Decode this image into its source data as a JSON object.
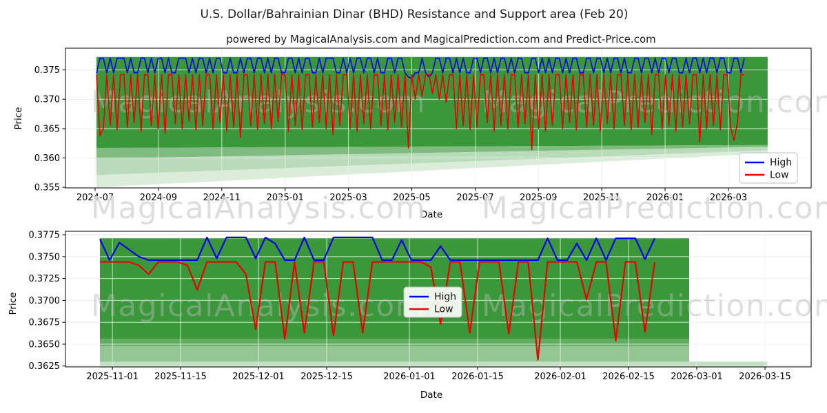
{
  "title": "U.S. Dollar/Bahrainian Dinar (BHD) Resistance and Support area (Feb 20)",
  "subtitle": "powered by MagicalAnalysis.com and MagicalPrediction.com and Predict-Price.com",
  "watermarks": {
    "left": "MagicalAnalysis.com",
    "right": "MagicalPrediction.com"
  },
  "legend": {
    "high": "High",
    "low": "Low"
  },
  "colors": {
    "high_line": "#0000EE",
    "low_line": "#EE0000",
    "band_green": "#3A973A",
    "grid_gray": "#cdcdcd",
    "grid_over_band": "rgba(255,255,255,0.75)",
    "axis": "#000000"
  },
  "chart_data": [
    {
      "type": "line",
      "position": "top",
      "xlabel": "Date",
      "ylabel": "Price",
      "ylim": [
        0.3549,
        0.3787
      ],
      "x_ticks": [
        {
          "label": "2024-07",
          "f": 0.0397
        },
        {
          "label": "2024-09",
          "f": 0.1247
        },
        {
          "label": "2024-11",
          "f": 0.2096
        },
        {
          "label": "2025-01",
          "f": 0.2946
        },
        {
          "label": "2025-03",
          "f": 0.3795
        },
        {
          "label": "2025-05",
          "f": 0.4644
        },
        {
          "label": "2025-07",
          "f": 0.5494
        },
        {
          "label": "2025-09",
          "f": 0.6343
        },
        {
          "label": "2025-11",
          "f": 0.7192
        },
        {
          "label": "2026-01",
          "f": 0.8042
        },
        {
          "label": "2026-03",
          "f": 0.8891
        }
      ],
      "y_ticks": [
        {
          "label": "0.355",
          "v": 0.355
        },
        {
          "label": "0.360",
          "v": 0.36
        },
        {
          "label": "0.365",
          "v": 0.365
        },
        {
          "label": "0.370",
          "v": 0.37
        },
        {
          "label": "0.375",
          "v": 0.375
        }
      ],
      "span": {
        "f0": 0.0416,
        "f1": 0.9104
      },
      "line_width": 1.6,
      "band_color": "#3A973A",
      "bands": [
        {
          "f0": 0.0416,
          "f1": 0.9417,
          "top0": 0.3772,
          "top1": 0.3772,
          "bot0": 0.3617,
          "bot1": 0.3622,
          "opacity": 1
        },
        {
          "f0": 0.0416,
          "f1": 0.9417,
          "top0": 0.3617,
          "top1": 0.3622,
          "bot0": 0.3599,
          "bot1": 0.3619,
          "opacity": 0.65
        },
        {
          "f0": 0.0416,
          "f1": 0.9417,
          "top0": 0.3599,
          "top1": 0.3619,
          "bot0": 0.3571,
          "bot1": 0.3613,
          "opacity": 0.35
        },
        {
          "f0": 0.0416,
          "f1": 0.9417,
          "top0": 0.3571,
          "top1": 0.3613,
          "bot0": 0.355,
          "bot1": 0.3608,
          "opacity": 0.18
        }
      ],
      "series": [
        {
          "name": "High",
          "color": "#0000EE",
          "values": [
            0.3744,
            0.377,
            0.377,
            0.3745,
            0.377,
            0.3745,
            0.377,
            0.377,
            0.377,
            0.3745,
            0.377,
            0.3745,
            0.3745,
            0.377,
            0.377,
            0.3745,
            0.377,
            0.3745,
            0.377,
            0.377,
            0.3745,
            0.377,
            0.3745,
            0.3745,
            0.377,
            0.377,
            0.377,
            0.3745,
            0.377,
            0.3745,
            0.377,
            0.377,
            0.3745,
            0.377,
            0.3745,
            0.377,
            0.377,
            0.3745,
            0.3745,
            0.377,
            0.3745,
            0.3745,
            0.377,
            0.3745,
            0.377,
            0.377,
            0.3745,
            0.377,
            0.377,
            0.3745,
            0.377,
            0.3745,
            0.377,
            0.377,
            0.3745,
            0.3745,
            0.377,
            0.377,
            0.3745,
            0.377,
            0.3745,
            0.377,
            0.377,
            0.3745,
            0.3745,
            0.377,
            0.3745,
            0.377,
            0.377,
            0.377,
            0.3745,
            0.3745,
            0.377,
            0.3745,
            0.377,
            0.3745,
            0.377,
            0.377,
            0.3745,
            0.377,
            0.377,
            0.3745,
            0.377,
            0.3745,
            0.3745,
            0.377,
            0.377,
            0.3745,
            0.377,
            0.377,
            0.3745,
            0.3738,
            0.3735,
            0.3745,
            0.3745,
            0.377,
            0.3745,
            0.3738,
            0.3745,
            0.377,
            0.377,
            0.3745,
            0.377,
            0.377,
            0.3745,
            0.377,
            0.3745,
            0.377,
            0.3745,
            0.3745,
            0.377,
            0.377,
            0.3745,
            0.377,
            0.377,
            0.3745,
            0.377,
            0.3745,
            0.377,
            0.377,
            0.3745,
            0.377,
            0.3745,
            0.377,
            0.377,
            0.3745,
            0.3745,
            0.377,
            0.377,
            0.3745,
            0.377,
            0.3745,
            0.377,
            0.3745,
            0.377,
            0.377,
            0.3745,
            0.377,
            0.3745,
            0.377,
            0.377,
            0.3745,
            0.3745,
            0.377,
            0.377,
            0.3745,
            0.377,
            0.377,
            0.3745,
            0.377,
            0.3745,
            0.377,
            0.377,
            0.3745,
            0.377,
            0.3745,
            0.3745,
            0.377,
            0.377,
            0.3745,
            0.377,
            0.377,
            0.3745,
            0.377,
            0.3745,
            0.377,
            0.377,
            0.3745,
            0.377,
            0.377,
            0.3745,
            0.3745,
            0.377,
            0.3745,
            0.377,
            0.377,
            0.3745,
            0.377,
            0.3745,
            0.377,
            0.377,
            0.3745,
            0.377,
            0.377,
            0.3745,
            0.3745,
            0.377,
            0.377,
            0.3745,
            0.377
          ]
        },
        {
          "name": "Low",
          "color": "#EE0000",
          "values": [
            0.3742,
            0.3638,
            0.365,
            0.3742,
            0.3655,
            0.3742,
            0.3648,
            0.3742,
            0.3742,
            0.3652,
            0.3742,
            0.366,
            0.3742,
            0.3645,
            0.3742,
            0.3742,
            0.3655,
            0.3742,
            0.365,
            0.3742,
            0.3642,
            0.3742,
            0.3742,
            0.3658,
            0.3742,
            0.365,
            0.3742,
            0.3663,
            0.3742,
            0.3648,
            0.3742,
            0.3655,
            0.3742,
            0.3742,
            0.365,
            0.3742,
            0.366,
            0.3742,
            0.3645,
            0.3742,
            0.3652,
            0.3742,
            0.3635,
            0.3742,
            0.3742,
            0.3655,
            0.3742,
            0.3648,
            0.3742,
            0.3658,
            0.3742,
            0.365,
            0.3742,
            0.3662,
            0.3742,
            0.3742,
            0.3645,
            0.3742,
            0.3655,
            0.3742,
            0.3648,
            0.3742,
            0.3742,
            0.3652,
            0.3742,
            0.366,
            0.3742,
            0.365,
            0.3742,
            0.364,
            0.3742,
            0.3655,
            0.3742,
            0.3742,
            0.365,
            0.3742,
            0.3645,
            0.3742,
            0.3658,
            0.3742,
            0.365,
            0.3742,
            0.3742,
            0.3655,
            0.3742,
            0.3648,
            0.3742,
            0.366,
            0.3742,
            0.3652,
            0.3742,
            0.3617,
            0.3742,
            0.37,
            0.3742,
            0.3705,
            0.3742,
            0.3742,
            0.371,
            0.3742,
            0.37,
            0.3742,
            0.3695,
            0.3742,
            0.3742,
            0.365,
            0.3742,
            0.3655,
            0.3742,
            0.3648,
            0.3742,
            0.3652,
            0.3742,
            0.3742,
            0.366,
            0.3742,
            0.3645,
            0.3742,
            0.3655,
            0.3742,
            0.365,
            0.3742,
            0.3742,
            0.3652,
            0.3742,
            0.3658,
            0.3742,
            0.3614,
            0.3742,
            0.365,
            0.3742,
            0.3645,
            0.3742,
            0.3655,
            0.3742,
            0.3742,
            0.365,
            0.3742,
            0.366,
            0.3742,
            0.3648,
            0.3742,
            0.3742,
            0.3652,
            0.3742,
            0.3655,
            0.3742,
            0.3645,
            0.3742,
            0.3658,
            0.3742,
            0.365,
            0.3742,
            0.3742,
            0.3655,
            0.3742,
            0.3648,
            0.3742,
            0.3652,
            0.3742,
            0.366,
            0.3742,
            0.364,
            0.3742,
            0.3742,
            0.365,
            0.3742,
            0.3655,
            0.3742,
            0.3645,
            0.3742,
            0.3652,
            0.3742,
            0.3658,
            0.3742,
            0.3742,
            0.3627,
            0.3742,
            0.365,
            0.3742,
            0.3655,
            0.3742,
            0.3648,
            0.3742,
            0.3742,
            0.3652,
            0.363,
            0.366,
            0.3742,
            0.3742
          ]
        }
      ]
    },
    {
      "type": "line",
      "position": "bottom",
      "xlabel": "Date",
      "ylabel": "Price",
      "ylim": [
        0.3624,
        0.3779
      ],
      "x_ticks": [
        {
          "label": "2025-11-01",
          "f": 0.0629
        },
        {
          "label": "2025-11-15",
          "f": 0.1543
        },
        {
          "label": "2025-12-01",
          "f": 0.2588
        },
        {
          "label": "2025-12-15",
          "f": 0.3503
        },
        {
          "label": "2026-01-01",
          "f": 0.4612
        },
        {
          "label": "2026-01-15",
          "f": 0.5527
        },
        {
          "label": "2026-02-01",
          "f": 0.6636
        },
        {
          "label": "2026-02-15",
          "f": 0.7551
        },
        {
          "label": "2026-03-01",
          "f": 0.8466
        },
        {
          "label": "2026-03-15",
          "f": 0.9381
        }
      ],
      "y_ticks": [
        {
          "label": "0.3625",
          "v": 0.3625
        },
        {
          "label": "0.3650",
          "v": 0.365
        },
        {
          "label": "0.3675",
          "v": 0.3675
        },
        {
          "label": "0.3700",
          "v": 0.37
        },
        {
          "label": "0.3725",
          "v": 0.3725
        },
        {
          "label": "0.3750",
          "v": 0.375
        },
        {
          "label": "0.3775",
          "v": 0.3775
        }
      ],
      "span": {
        "f0": 0.0462,
        "f1": 0.7902
      },
      "line_width": 2.2,
      "band_color": "#3A973A",
      "bands": [
        {
          "f0": 0.0462,
          "f1": 0.8364,
          "top0": 0.3771,
          "top1": 0.3771,
          "bot0": 0.3656,
          "bot1": 0.3656,
          "opacity": 1
        },
        {
          "f0": 0.0462,
          "f1": 0.8364,
          "top0": 0.3656,
          "top1": 0.3656,
          "bot0": 0.3648,
          "bot1": 0.3648,
          "opacity": 0.8
        },
        {
          "f0": 0.0462,
          "f1": 0.8364,
          "top0": 0.3648,
          "top1": 0.3648,
          "bot0": 0.363,
          "bot1": 0.363,
          "opacity": 0.55
        },
        {
          "f0": 0.0462,
          "f1": 0.9409,
          "top0": 0.363,
          "top1": 0.363,
          "bot0": 0.3623,
          "bot1": 0.3623,
          "opacity": 0.3
        }
      ],
      "series": [
        {
          "name": "High",
          "color": "#0000EE",
          "values": [
            0.377,
            0.3746,
            0.3766,
            0.3758,
            0.375,
            0.3746,
            0.3746,
            0.3746,
            0.3746,
            0.3746,
            0.3746,
            0.3772,
            0.3748,
            0.3772,
            0.3772,
            0.3772,
            0.3748,
            0.3772,
            0.3765,
            0.3746,
            0.3746,
            0.3772,
            0.3746,
            0.3746,
            0.3772,
            0.3772,
            0.3772,
            0.3772,
            0.3772,
            0.3746,
            0.3746,
            0.3769,
            0.3746,
            0.3746,
            0.3746,
            0.3762,
            0.3746,
            0.3746,
            0.3746,
            0.3746,
            0.3746,
            0.3746,
            0.3746,
            0.3746,
            0.3746,
            0.3746,
            0.3771,
            0.3746,
            0.3746,
            0.3765,
            0.3746,
            0.3771,
            0.3746,
            0.3771,
            0.3771,
            0.3771,
            0.3747,
            0.3771
          ]
        },
        {
          "name": "Low",
          "color": "#EE0000",
          "values": [
            0.3744,
            0.3744,
            0.3744,
            0.3744,
            0.374,
            0.373,
            0.3744,
            0.3744,
            0.3744,
            0.374,
            0.3712,
            0.3744,
            0.3744,
            0.3744,
            0.3744,
            0.373,
            0.3667,
            0.3744,
            0.3744,
            0.3656,
            0.3744,
            0.3663,
            0.3744,
            0.3744,
            0.366,
            0.3744,
            0.3744,
            0.3663,
            0.3744,
            0.3744,
            0.3744,
            0.3744,
            0.3744,
            0.3744,
            0.3738,
            0.3673,
            0.3744,
            0.3744,
            0.3663,
            0.3744,
            0.3744,
            0.3744,
            0.3662,
            0.3744,
            0.3744,
            0.3632,
            0.3744,
            0.3744,
            0.3744,
            0.3744,
            0.3701,
            0.3744,
            0.3744,
            0.3654,
            0.3744,
            0.3744,
            0.3664,
            0.3744
          ]
        }
      ]
    }
  ]
}
